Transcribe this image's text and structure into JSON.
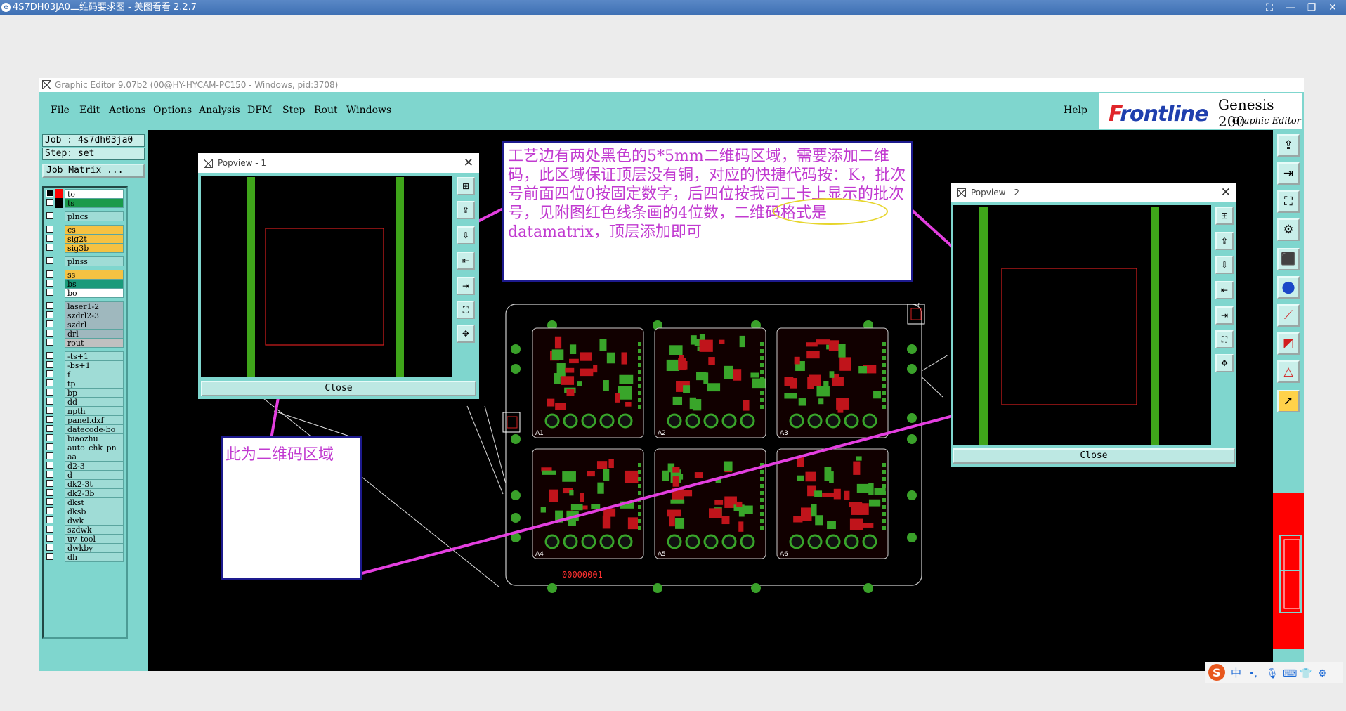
{
  "viewer": {
    "title": "4S7DH03JA0二维码要求图 - 美图看看 2.2.7",
    "controls": [
      "⛶",
      "—",
      "❐",
      "✕"
    ]
  },
  "editor": {
    "title": "Graphic Editor 9.07b2 (00@HY-HYCAM-PC150 - Windows, pid:3708)",
    "menu": [
      "File",
      "Edit",
      "Actions",
      "Options",
      "Analysis",
      "DFM",
      "Step",
      "Rout",
      "Windows"
    ],
    "help": "Help",
    "brand": {
      "logo_f": "F",
      "logo_rest": "rontline",
      "product": "Genesis 200",
      "subtitle": "Graphic Editor"
    }
  },
  "left_panel": {
    "job": "Job : 4s7dh03ja0",
    "step": "Step: set",
    "job_matrix": "Job Matrix ...",
    "layers": [
      {
        "name": "to",
        "color": "#ffffff",
        "flag": "#ff0000",
        "on": true
      },
      {
        "name": "ts",
        "color": "#1a9a4a",
        "flag": "#000000",
        "on": false
      },
      {
        "name": "plncs",
        "color": "#9fdcd6",
        "flag": "",
        "on": false
      },
      {
        "name": "cs",
        "color": "#f5c242",
        "flag": "",
        "on": false
      },
      {
        "name": "sig2t",
        "color": "#f5c242",
        "flag": "",
        "on": false
      },
      {
        "name": "sig3b",
        "color": "#f5c242",
        "flag": "",
        "on": false
      },
      {
        "name": "plnss",
        "color": "#9fdcd6",
        "flag": "",
        "on": false
      },
      {
        "name": "ss",
        "color": "#f5c242",
        "flag": "",
        "on": false
      },
      {
        "name": "bs",
        "color": "#1a9a7a",
        "flag": "",
        "on": false
      },
      {
        "name": "bo",
        "color": "#ffffff",
        "flag": "",
        "on": false
      },
      {
        "name": "laser1-2",
        "color": "#9fb8be",
        "flag": "",
        "on": false
      },
      {
        "name": "szdrl2-3",
        "color": "#9fb8be",
        "flag": "",
        "on": false
      },
      {
        "name": "szdrl",
        "color": "#9fb8be",
        "flag": "",
        "on": false
      },
      {
        "name": "drl",
        "color": "#9fb8be",
        "flag": "",
        "on": false
      },
      {
        "name": "rout",
        "color": "#c0c0c0",
        "flag": "",
        "on": false
      },
      {
        "name": "-ts+1",
        "color": "#9fdcd6",
        "flag": "",
        "on": false
      },
      {
        "name": "-bs+1",
        "color": "#9fdcd6",
        "flag": "",
        "on": false
      },
      {
        "name": "f",
        "color": "#9fdcd6",
        "flag": "",
        "on": false
      },
      {
        "name": "tp",
        "color": "#9fdcd6",
        "flag": "",
        "on": false
      },
      {
        "name": "bp",
        "color": "#9fdcd6",
        "flag": "",
        "on": false
      },
      {
        "name": "dd",
        "color": "#9fdcd6",
        "flag": "",
        "on": false
      },
      {
        "name": "npth",
        "color": "#9fdcd6",
        "flag": "",
        "on": false
      },
      {
        "name": "panel.dxf",
        "color": "#9fdcd6",
        "flag": "",
        "on": false
      },
      {
        "name": "datecode-bo",
        "color": "#9fdcd6",
        "flag": "",
        "on": false
      },
      {
        "name": "biaozhu",
        "color": "#9fdcd6",
        "flag": "",
        "on": false
      },
      {
        "name": "auto_chk_pn",
        "color": "#9fdcd6",
        "flag": "",
        "on": false
      },
      {
        "name": "aa",
        "color": "#9fdcd6",
        "flag": "",
        "on": false
      },
      {
        "name": "d2-3",
        "color": "#9fdcd6",
        "flag": "",
        "on": false
      },
      {
        "name": "d",
        "color": "#9fdcd6",
        "flag": "",
        "on": false
      },
      {
        "name": "dk2-3t",
        "color": "#9fdcd6",
        "flag": "",
        "on": false
      },
      {
        "name": "dk2-3b",
        "color": "#9fdcd6",
        "flag": "",
        "on": false
      },
      {
        "name": "dkst",
        "color": "#9fdcd6",
        "flag": "",
        "on": false
      },
      {
        "name": "dksb",
        "color": "#9fdcd6",
        "flag": "",
        "on": false
      },
      {
        "name": "dwk",
        "color": "#9fdcd6",
        "flag": "",
        "on": false
      },
      {
        "name": "szdwk",
        "color": "#9fdcd6",
        "flag": "",
        "on": false
      },
      {
        "name": "uv_tool",
        "color": "#9fdcd6",
        "flag": "",
        "on": false
      },
      {
        "name": "dwkby",
        "color": "#9fdcd6",
        "flag": "",
        "on": false
      },
      {
        "name": "dh",
        "color": "#9fdcd6",
        "flag": "",
        "on": false
      }
    ]
  },
  "popview1": {
    "title": "Popview - 1",
    "close_label": "Close",
    "close_x": "✕"
  },
  "popview2": {
    "title": "Popview - 2",
    "close_label": "Close",
    "close_x": "✕"
  },
  "annotations": {
    "main_note": "工艺边有两处黑色的5*5mm二维码区域，需要添加二维码，此区域保证顶层没有铜，对应的快捷代码按：K，批次号前面四位0按固定数字，后四位按我司工卡上显示的批次号，见附图红色线条画的4位数，二维码格式是datamatrix，顶层添加即可",
    "qr_note": "此为二维码区域"
  },
  "board": {
    "serial": "00000001",
    "panel_labels": [
      "A1",
      "A2",
      "A3",
      "A4",
      "A5",
      "A6"
    ]
  },
  "right_toolbar_icons": [
    "export-icon",
    "import-icon",
    "fit-icon",
    "tools-icon",
    "select-icon",
    "net-icon",
    "measure-icon",
    "snap-icon",
    "triangle-icon",
    "pointer-icon"
  ],
  "ime": {
    "label": "中"
  }
}
